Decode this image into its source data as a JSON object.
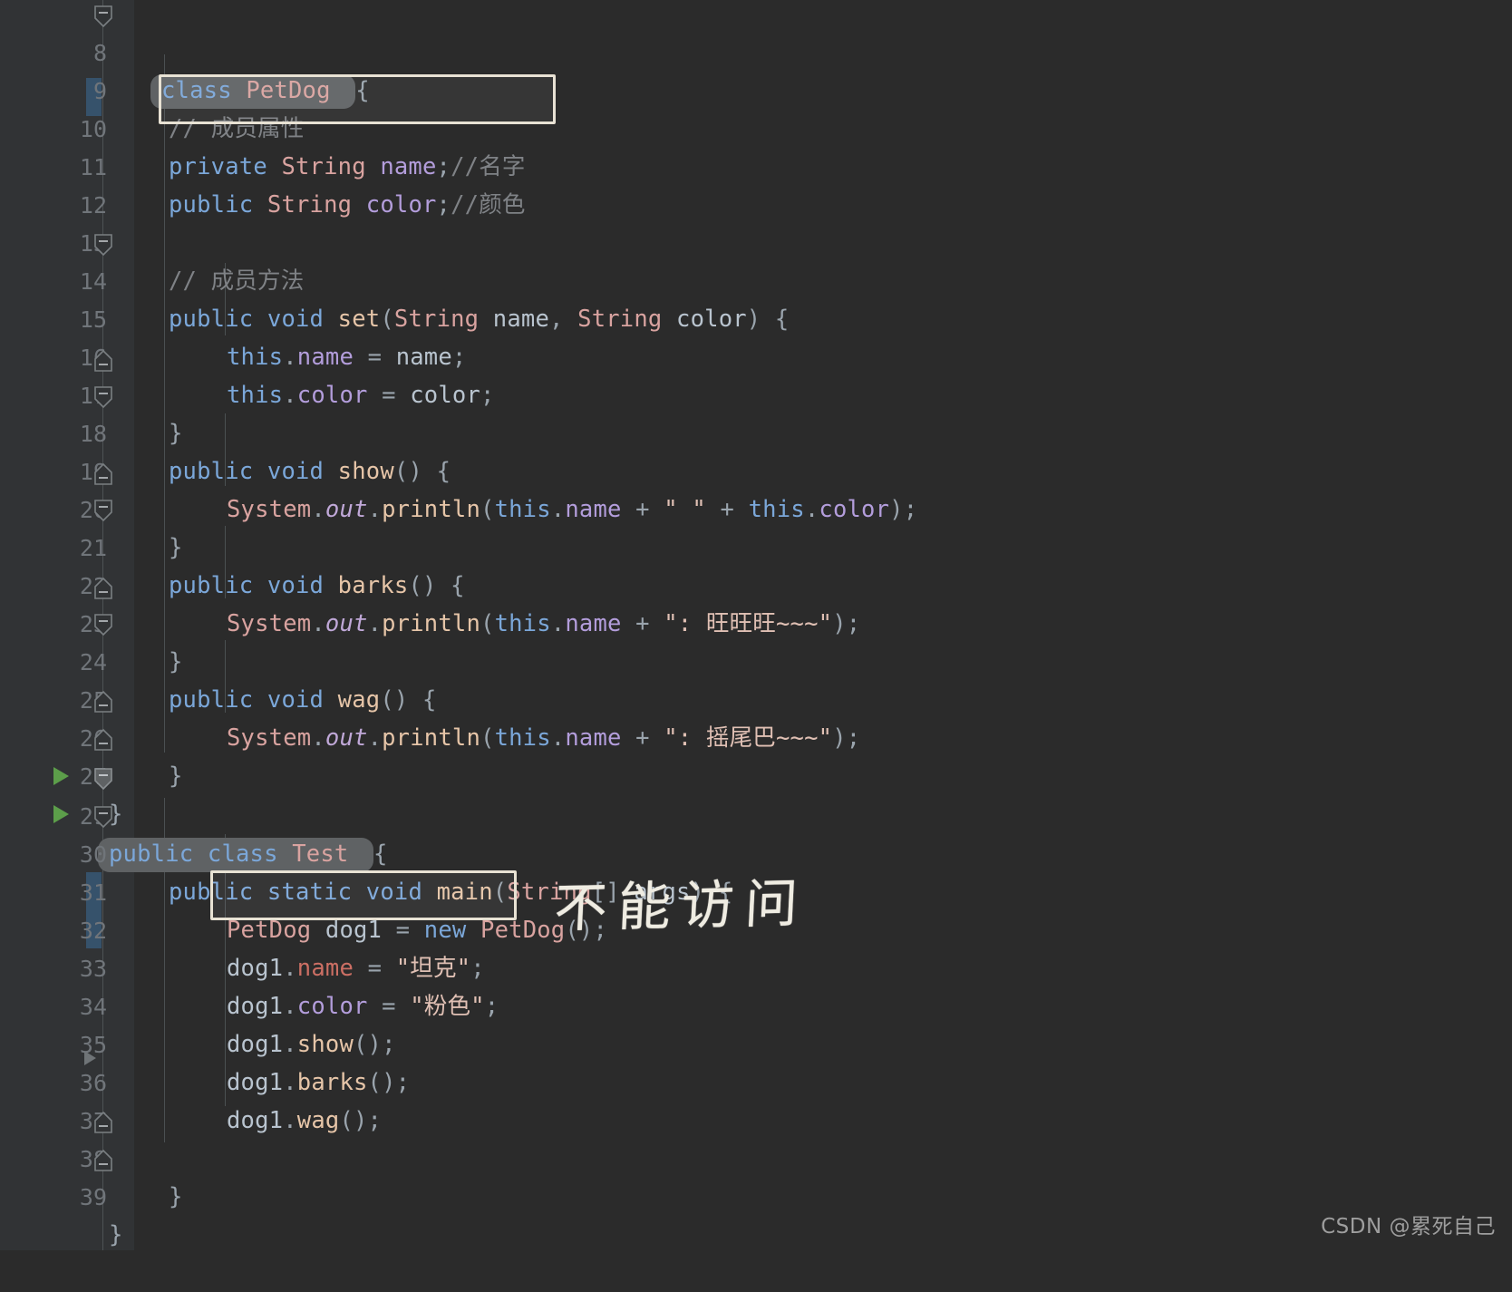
{
  "editor": {
    "theme": "darcula",
    "background": "#2b2b2b",
    "gutter_background": "#313335",
    "accent_run": "#5c9e4a",
    "accent_change_bar": "#36526b",
    "highlight_pill": "#5f6264",
    "annotation_box_border": "#e8e2d4"
  },
  "lines": [
    {
      "n": "8",
      "indent": 0
    },
    {
      "n": "9",
      "indent": 1
    },
    {
      "n": "10",
      "indent": 1
    },
    {
      "n": "11",
      "indent": 1
    },
    {
      "n": "12",
      "indent": 0
    },
    {
      "n": "13",
      "indent": 1
    },
    {
      "n": "14",
      "indent": 1
    },
    {
      "n": "15",
      "indent": 2
    },
    {
      "n": "16",
      "indent": 2
    },
    {
      "n": "17",
      "indent": 1
    },
    {
      "n": "18",
      "indent": 1
    },
    {
      "n": "19",
      "indent": 2
    },
    {
      "n": "20",
      "indent": 1
    },
    {
      "n": "21",
      "indent": 1
    },
    {
      "n": "22",
      "indent": 2
    },
    {
      "n": "23",
      "indent": 1
    },
    {
      "n": "24",
      "indent": 1
    },
    {
      "n": "25",
      "indent": 2
    },
    {
      "n": "26",
      "indent": 1
    },
    {
      "n": "27",
      "indent": 0
    },
    {
      "n": "29",
      "indent": 0
    },
    {
      "n": "30",
      "indent": 1
    },
    {
      "n": "31",
      "indent": 2
    },
    {
      "n": "32",
      "indent": 2
    },
    {
      "n": "33",
      "indent": 2
    },
    {
      "n": "34",
      "indent": 2
    },
    {
      "n": "35",
      "indent": 2
    },
    {
      "n": "36",
      "indent": 2
    },
    {
      "n": "37",
      "indent": 2
    },
    {
      "n": "38",
      "indent": 1
    },
    {
      "n": "39",
      "indent": 0
    }
  ],
  "code_text": {
    "l8": "class PetDog {",
    "l9": "    // 成员属性",
    "l10": "    private String name;//名字",
    "l11": "    public String color;//颜色",
    "l12": "",
    "l13": "    // 成员方法",
    "l14": "    public void set(String name, String color) {",
    "l15": "        this.name = name;",
    "l16": "        this.color = color;",
    "l17": "    }",
    "l18": "    public void show() {",
    "l19": "        System.out.println(this.name + \" \" + this.color);",
    "l20": "    }",
    "l21": "    public void barks() {",
    "l22": "        System.out.println(this.name + \": 旺旺旺~~~\");",
    "l23": "    }",
    "l24": "    public void wag() {",
    "l25": "        System.out.println(this.name + \": 摇尾巴~~~\");",
    "l26": "    }",
    "l27": "}",
    "l29": "public class Test {",
    "l30": "    public static void main(String[] args) {",
    "l31": "        PetDog dog1 = new PetDog();",
    "l32": "        dog1.name = \"坦克\";",
    "l33": "        dog1.color = \"粉色\";",
    "l34": "        dog1.show();",
    "l35": "        dog1.barks();",
    "l36": "        dog1.wag();",
    "l37": "",
    "l38": "    }",
    "l39": "}"
  },
  "tokens": {
    "kw_class": "class",
    "kw_private": "private",
    "kw_public": "public",
    "kw_void": "void",
    "kw_static": "static",
    "kw_new": "new",
    "kw_this": "this",
    "type_petdog": "PetDog",
    "type_string": "String",
    "field_name": "name",
    "field_color": "color",
    "m_set": "set",
    "m_show": "show",
    "m_barks": "barks",
    "m_wag": "wag",
    "m_main": "main",
    "m_println": "println",
    "cls_system": "System",
    "stat_out": "out",
    "var_dog1": "dog1",
    "cls_test": "Test",
    "comment_attrs": "// 成员属性",
    "comment_methods": "// 成员方法",
    "comment_name": "//名字",
    "comment_color": "//颜色",
    "str_space": "\" \"",
    "str_bark": "\": 旺旺旺~~~\"",
    "str_wag": "\": 摇尾巴~~~\"",
    "str_tanke": "\"坦克\"",
    "str_fense": "\"粉色\""
  },
  "annotations": {
    "handwritten_note": "不能访问",
    "boxed_line_10": "private String name;//名字",
    "boxed_line_32": "dog1.name = \"坦克\";"
  },
  "watermark": {
    "text": "CSDN @累死自己"
  },
  "gutter": {
    "run_arrow_lines": [
      "29",
      "30"
    ],
    "fold_open_lines": [
      "8",
      "14",
      "18",
      "21",
      "24",
      "29",
      "30"
    ],
    "fold_close_lines": [
      "17",
      "20",
      "23",
      "26",
      "27",
      "38",
      "39"
    ],
    "change_bar_lines": [
      "10",
      "32",
      "33"
    ]
  }
}
